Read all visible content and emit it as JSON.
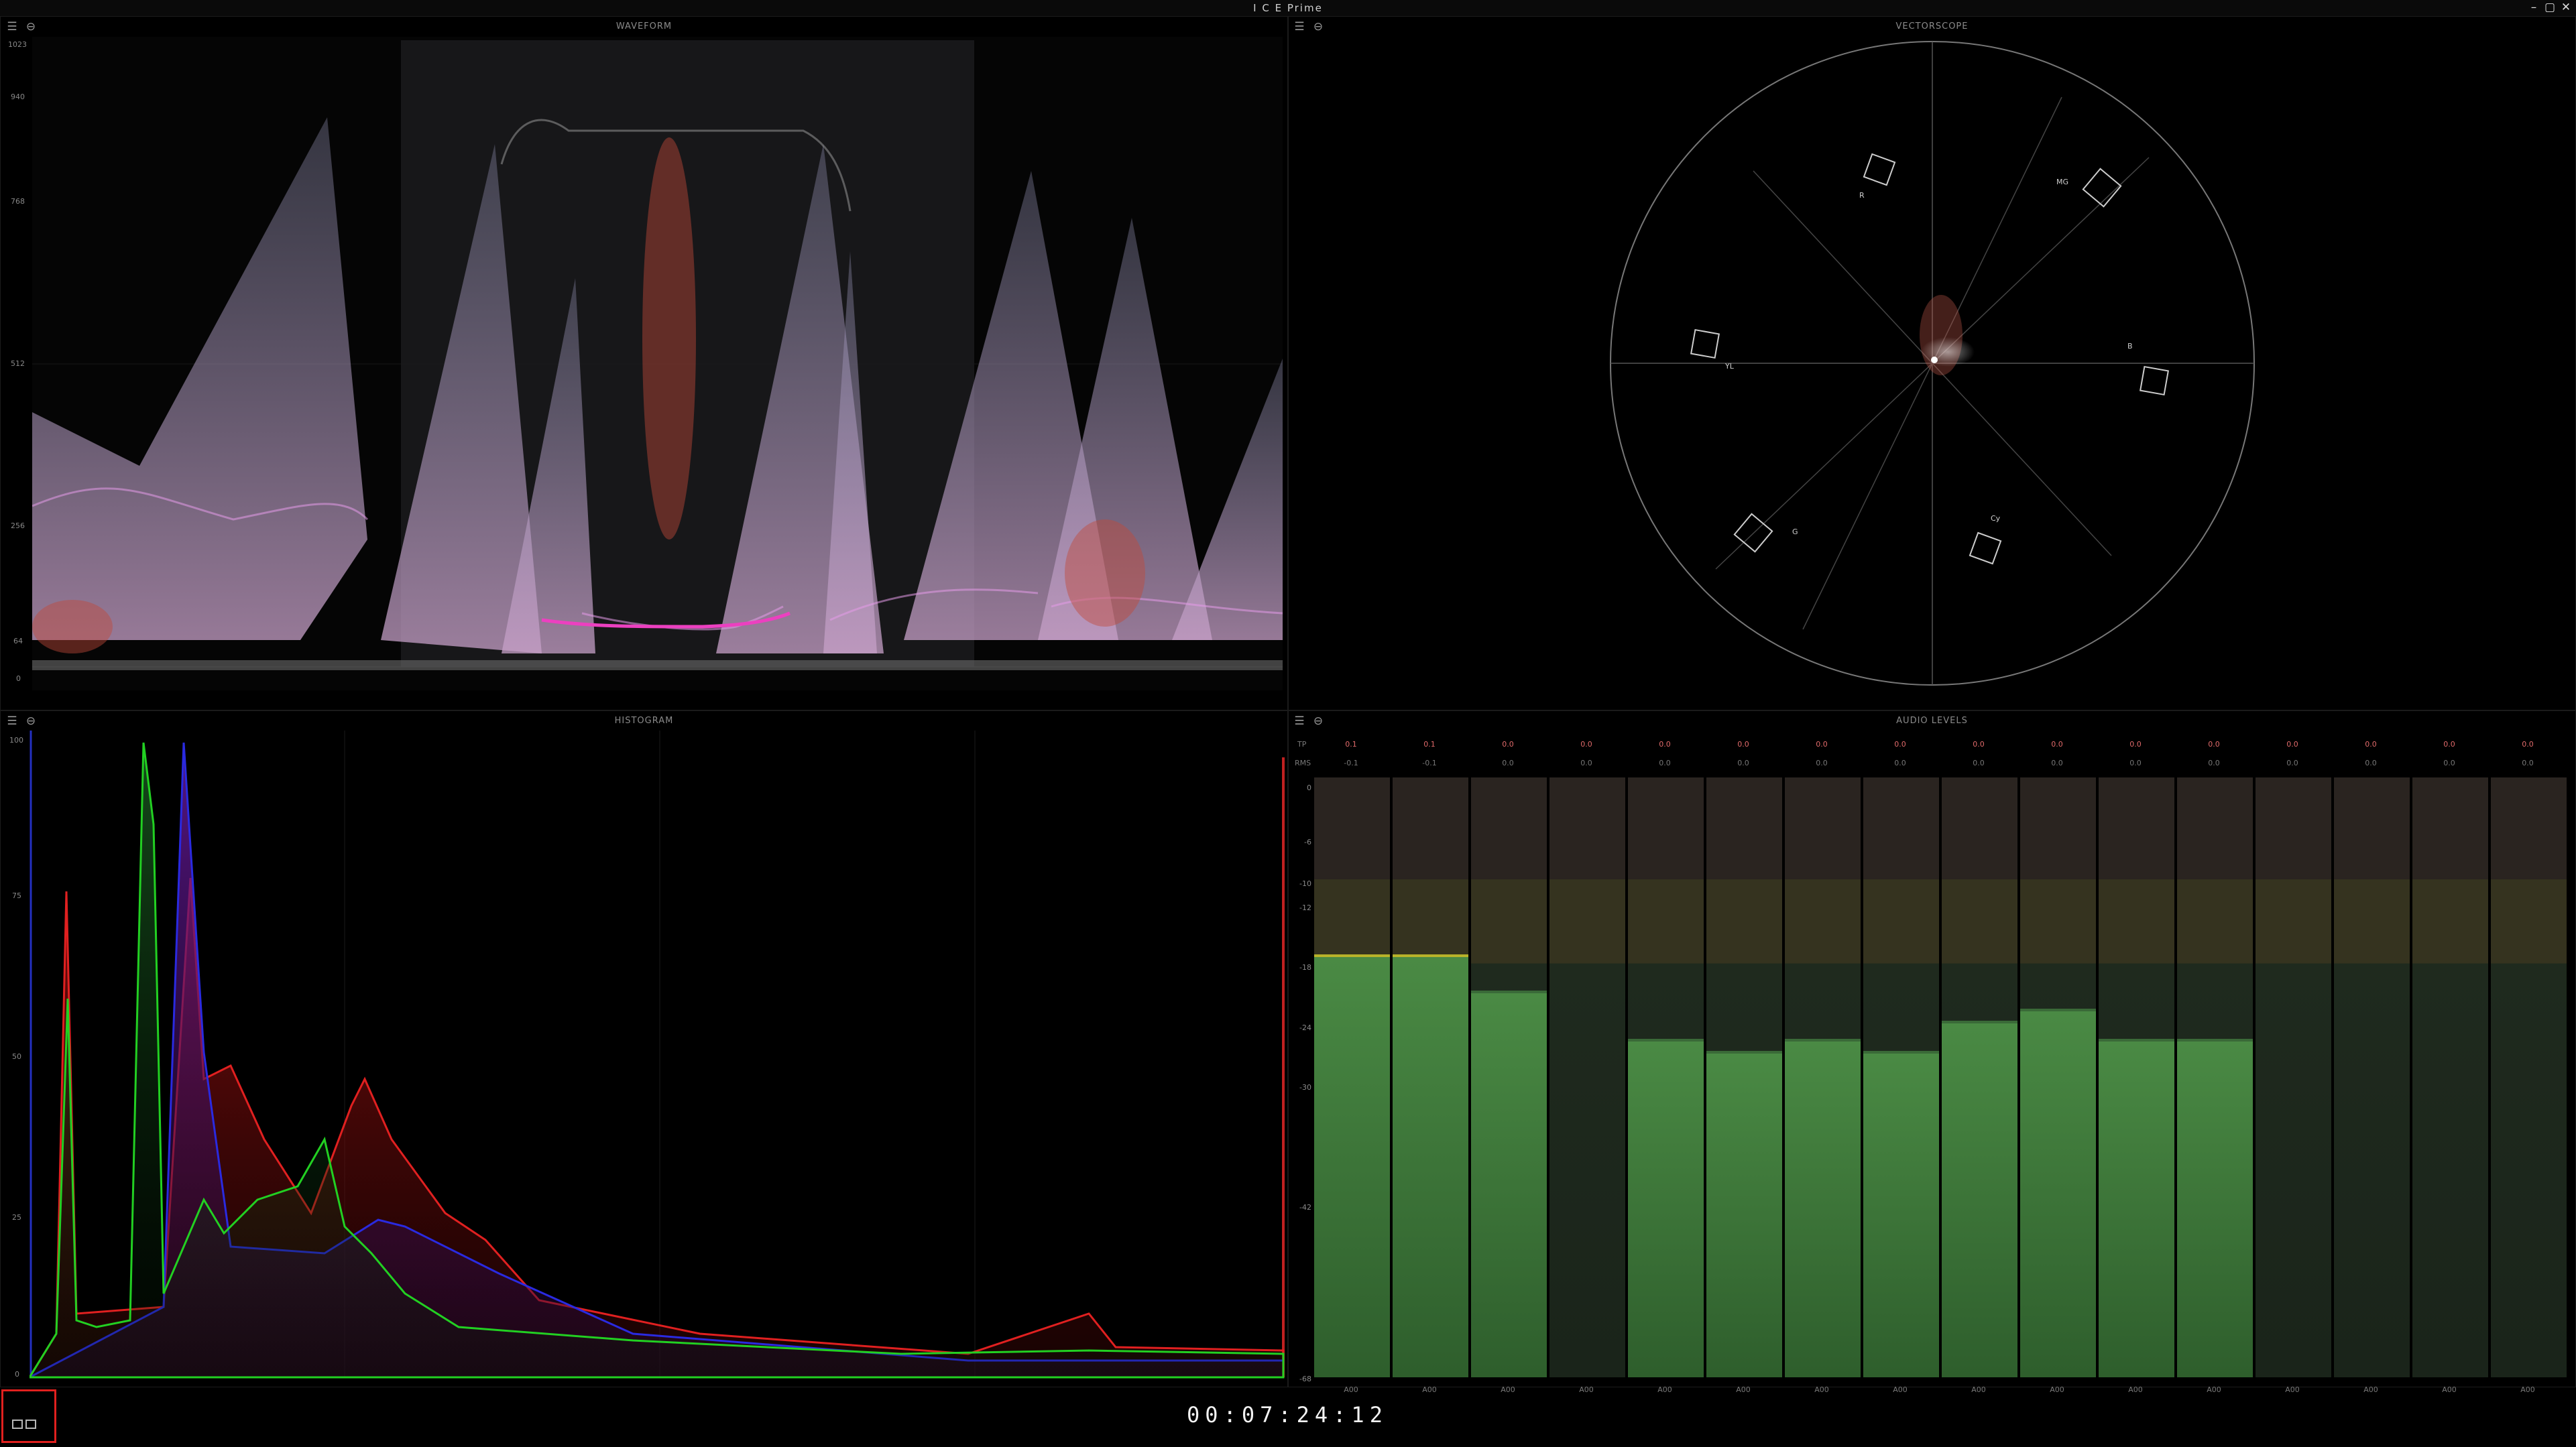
{
  "app": {
    "title": "I C E Prime"
  },
  "window_controls": {
    "minimize": "–",
    "maximize": "▢",
    "close": "✕"
  },
  "panels": {
    "waveform": {
      "title": "WAVEFORM",
      "y_ticks": [
        "1023",
        "940",
        "768",
        "512",
        "256",
        "64",
        "0"
      ]
    },
    "vectorscope": {
      "title": "VECTORSCOPE",
      "targets": [
        "R",
        "MG",
        "B",
        "Cy",
        "G",
        "YL"
      ]
    },
    "histogram": {
      "title": "HISTOGRAM",
      "y_ticks": [
        "100",
        "75",
        "50",
        "25",
        "0"
      ]
    },
    "audio": {
      "title": "AUDIO LEVELS",
      "row_labels": [
        "TP",
        "RMS"
      ],
      "scale": [
        "0",
        "-6",
        "-10",
        "-12",
        "-18",
        "-24",
        "-30",
        "-42",
        "-68"
      ],
      "channels": [
        {
          "peak": "0.1",
          "rms": "-0.1",
          "level": 0.7,
          "active": true,
          "source": "A00"
        },
        {
          "peak": "0.1",
          "rms": "-0.1",
          "level": 0.7,
          "active": true,
          "source": "A00"
        },
        {
          "peak": "0.0",
          "rms": "0.0",
          "level": 0.64,
          "active": true,
          "source": "A00"
        },
        {
          "peak": "0.0",
          "rms": "0.0",
          "level": 0.0,
          "active": false,
          "source": "A00"
        },
        {
          "peak": "0.0",
          "rms": "0.0",
          "level": 0.56,
          "active": true,
          "source": "A00"
        },
        {
          "peak": "0.0",
          "rms": "0.0",
          "level": 0.54,
          "active": true,
          "source": "A00"
        },
        {
          "peak": "0.0",
          "rms": "0.0",
          "level": 0.56,
          "active": true,
          "source": "A00"
        },
        {
          "peak": "0.0",
          "rms": "0.0",
          "level": 0.54,
          "active": true,
          "source": "A00"
        },
        {
          "peak": "0.0",
          "rms": "0.0",
          "level": 0.59,
          "active": true,
          "source": "A00"
        },
        {
          "peak": "0.0",
          "rms": "0.0",
          "level": 0.61,
          "active": true,
          "source": "A00"
        },
        {
          "peak": "0.0",
          "rms": "0.0",
          "level": 0.56,
          "active": true,
          "source": "A00"
        },
        {
          "peak": "0.0",
          "rms": "0.0",
          "level": 0.56,
          "active": true,
          "source": "A00"
        },
        {
          "peak": "0.0",
          "rms": "0.0",
          "level": 0.0,
          "active": false,
          "source": "A00"
        },
        {
          "peak": "0.0",
          "rms": "0.0",
          "level": 0.0,
          "active": false,
          "source": "A00"
        },
        {
          "peak": "0.0",
          "rms": "0.0",
          "level": 0.0,
          "active": false,
          "source": "A00"
        },
        {
          "peak": "0.0",
          "rms": "0.0",
          "level": 0.0,
          "active": false,
          "source": "A00"
        }
      ]
    }
  },
  "timecode": "00:07:24:12",
  "colors": {
    "peak_text": "#e06a6a",
    "meter_green": "#3e7a3c",
    "meter_yellow": "#b8b22a"
  }
}
